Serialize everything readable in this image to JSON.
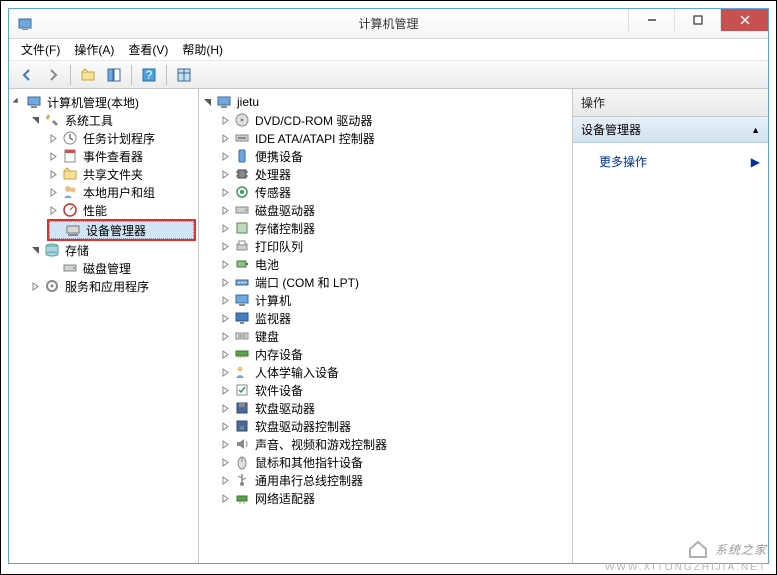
{
  "window": {
    "title": "计算机管理"
  },
  "menu": {
    "file": "文件(F)",
    "action": "操作(A)",
    "view": "查看(V)",
    "help": "帮助(H)"
  },
  "left_tree": {
    "root": "计算机管理(本地)",
    "system_tools": "系统工具",
    "task_scheduler": "任务计划程序",
    "event_viewer": "事件查看器",
    "shared_folders": "共享文件夹",
    "local_users": "本地用户和组",
    "performance": "性能",
    "device_manager": "设备管理器",
    "storage": "存储",
    "disk_mgmt": "磁盘管理",
    "services_apps": "服务和应用程序"
  },
  "center_tree": {
    "root": "jietu",
    "dvd": "DVD/CD-ROM 驱动器",
    "ide": "IDE ATA/ATAPI 控制器",
    "portable": "便携设备",
    "processor": "处理器",
    "sensor": "传感器",
    "disk_drive": "磁盘驱动器",
    "storage_ctrl": "存储控制器",
    "print_queue": "打印队列",
    "battery": "电池",
    "com_lpt": "端口 (COM 和 LPT)",
    "computer": "计算机",
    "monitor": "监视器",
    "keyboard": "键盘",
    "memory": "内存设备",
    "hid": "人体学输入设备",
    "software": "软件设备",
    "floppy_drive": "软盘驱动器",
    "floppy_ctrl": "软盘驱动器控制器",
    "audio": "声音、视频和游戏控制器",
    "mouse": "鼠标和其他指针设备",
    "usb": "通用串行总线控制器",
    "network": "网络适配器"
  },
  "actions": {
    "header": "操作",
    "section": "设备管理器",
    "more": "更多操作"
  },
  "watermark": {
    "text": "系统之家",
    "url": "WWW.XITONGZHIJIA.NET"
  }
}
